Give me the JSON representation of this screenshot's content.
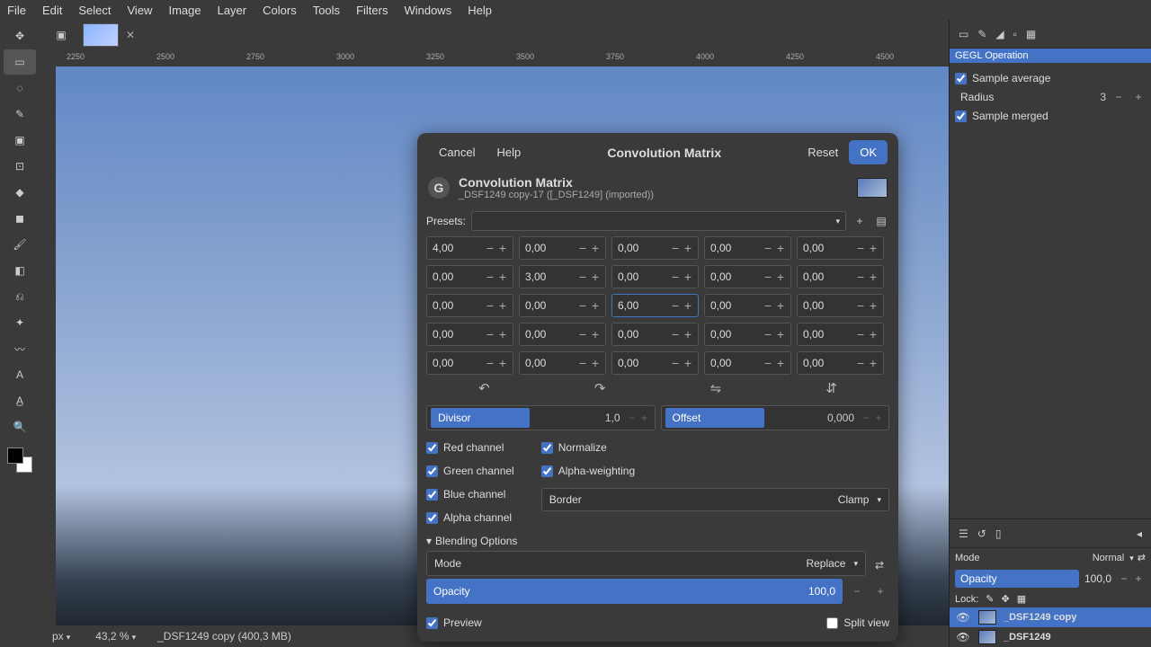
{
  "menus": [
    "File",
    "Edit",
    "Select",
    "View",
    "Image",
    "Layer",
    "Colors",
    "Tools",
    "Filters",
    "Windows",
    "Help"
  ],
  "ruler_ticks": [
    "2250",
    "2500",
    "2750",
    "3000",
    "3250",
    "3500",
    "3750",
    "4000",
    "4250",
    "4500"
  ],
  "statusbar": {
    "unit": "px",
    "zoom": "43,2 %",
    "file": "_DSF1249 copy (400,3 MB)"
  },
  "rp": {
    "title": "GEGL Operation",
    "sample_average": "Sample average",
    "radius_label": "Radius",
    "radius_value": "3",
    "sample_merged": "Sample merged"
  },
  "layerpanel": {
    "mode_label": "Mode",
    "mode_value": "Normal",
    "opacity_label": "Opacity",
    "opacity_value": "100,0",
    "lock_label": "Lock:",
    "layers": [
      {
        "name": "_DSF1249 copy"
      },
      {
        "name": "_DSF1249"
      }
    ]
  },
  "dialog": {
    "cancel": "Cancel",
    "help": "Help",
    "title": "Convolution Matrix",
    "reset": "Reset",
    "ok": "OK",
    "h_title": "Convolution Matrix",
    "h_sub": "_DSF1249 copy-17 ([_DSF1249] (imported))",
    "presets_label": "Presets:",
    "matrix": [
      [
        "4,00",
        "0,00",
        "0,00",
        "0,00",
        "0,00"
      ],
      [
        "0,00",
        "3,00",
        "0,00",
        "0,00",
        "0,00"
      ],
      [
        "0,00",
        "0,00",
        "6,00",
        "0,00",
        "0,00"
      ],
      [
        "0,00",
        "0,00",
        "0,00",
        "0,00",
        "0,00"
      ],
      [
        "0,00",
        "0,00",
        "0,00",
        "0,00",
        "0,00"
      ]
    ],
    "focused": [
      2,
      2
    ],
    "divisor_label": "Divisor",
    "divisor_value": "1,0",
    "offset_label": "Offset",
    "offset_value": "0,000",
    "channels": [
      "Red channel",
      "Green channel",
      "Blue channel",
      "Alpha channel"
    ],
    "normalize": "Normalize",
    "alpha_weighting": "Alpha-weighting",
    "border_label": "Border",
    "border_value": "Clamp",
    "blending_label": "Blending Options",
    "mode_label": "Mode",
    "mode_value": "Replace",
    "opacity_label": "Opacity",
    "opacity_value": "100,0",
    "preview": "Preview",
    "split_view": "Split view"
  }
}
